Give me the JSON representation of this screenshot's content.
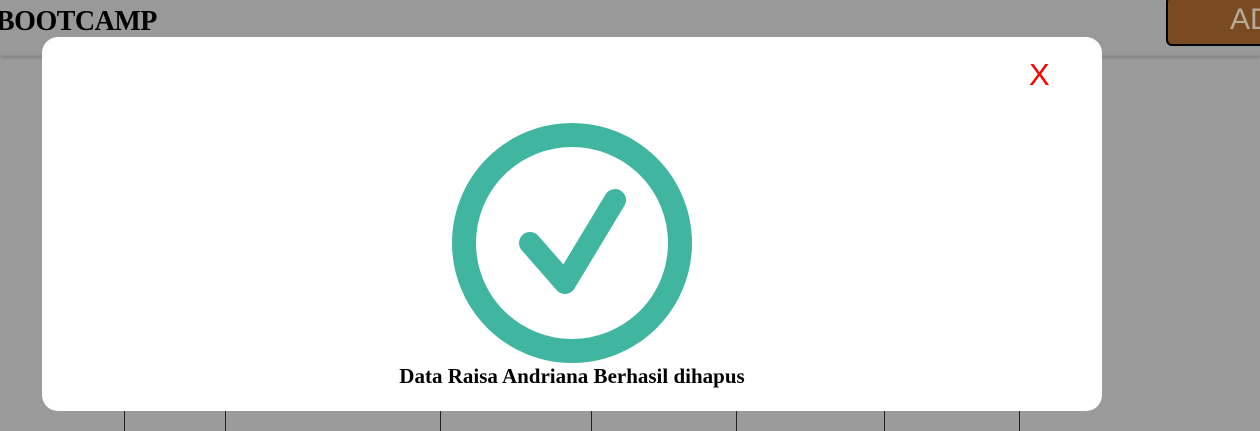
{
  "header": {
    "brand": "BOOTCAMP",
    "add_button_label": "AD"
  },
  "modal": {
    "close_label": "X",
    "message": "Data Raisa Andriana Berhasil dihapus",
    "icon": "check-circle-icon"
  },
  "colors": {
    "overlay_background": "#9b9b9b",
    "success_green": "#40b59f",
    "close_red": "#ff0000",
    "add_button_bg": "#7a4a23"
  }
}
